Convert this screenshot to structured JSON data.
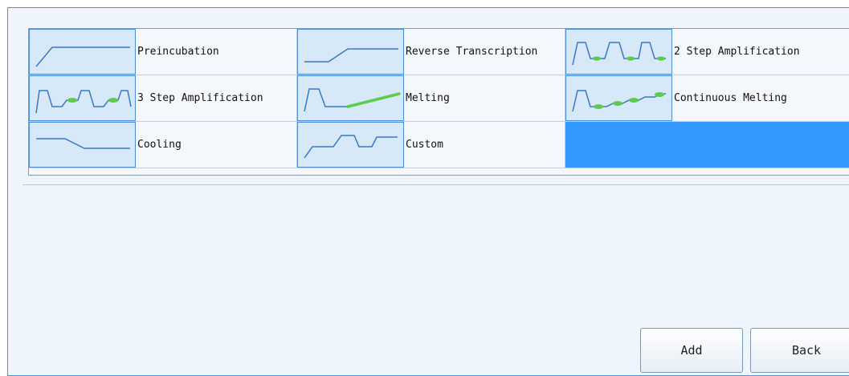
{
  "templates": [
    {
      "label": "Preincubation",
      "icon": "preincubation-curve-icon"
    },
    {
      "label": "Reverse Transcription",
      "icon": "reverse-transcription-curve-icon"
    },
    {
      "label": "2 Step Amplification",
      "icon": "two-step-amplification-curve-icon"
    },
    {
      "label": "3 Step Amplification",
      "icon": "three-step-amplification-curve-icon"
    },
    {
      "label": "Melting",
      "icon": "melting-curve-icon"
    },
    {
      "label": "Continuous Melting",
      "icon": "continuous-melting-curve-icon"
    },
    {
      "label": "Cooling",
      "icon": "cooling-curve-icon"
    },
    {
      "label": "Custom",
      "icon": "custom-curve-icon"
    },
    {
      "label": "",
      "icon": "",
      "selected": true
    }
  ],
  "buttons": {
    "add": "Add",
    "back": "Back"
  },
  "colors": {
    "curve": "#3a78c4",
    "acquisition": "#5ccc4a",
    "selection": "#3399ff"
  }
}
